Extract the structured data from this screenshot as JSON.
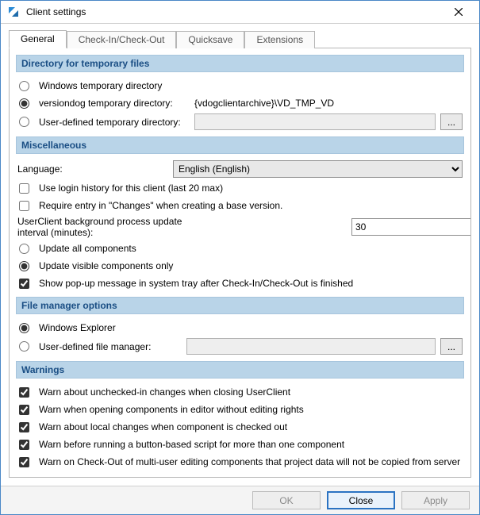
{
  "window": {
    "title": "Client settings"
  },
  "tabs": {
    "general": "General",
    "checkinout": "Check-In/Check-Out",
    "quicksave": "Quicksave",
    "extensions": "Extensions"
  },
  "sections": {
    "tempfiles": {
      "header": "Directory for temporary files",
      "opt_windows": "Windows temporary directory",
      "opt_vdog_label": "versiondog temporary directory:",
      "opt_vdog_value": "{vdogclientarchive}\\VD_TMP_VD",
      "opt_user_label": "User-defined temporary directory:",
      "browse": "..."
    },
    "misc": {
      "header": "Miscellaneous",
      "language_label": "Language:",
      "language_value": "English (English)",
      "use_login_history": "Use login history for this client (last 20 max)",
      "require_changes": "Require entry in \"Changes\" when creating a base version.",
      "bg_update_label_l1": "UserClient background process update",
      "bg_update_label_l2": "interval (minutes):",
      "bg_update_value": "30",
      "update_all": "Update all components",
      "update_visible": "Update visible components only",
      "show_popup": "Show pop-up message in system tray after Check-In/Check-Out is finished"
    },
    "fm": {
      "header": "File manager options",
      "explorer": "Windows Explorer",
      "user_fm_label": "User-defined file manager:",
      "browse": "..."
    },
    "warnings": {
      "header": "Warnings",
      "w1": "Warn about unchecked-in changes when closing UserClient",
      "w2": "Warn when opening components in editor without editing rights",
      "w3": "Warn about local changes when component is checked out",
      "w4": "Warn before running a button-based script for more than one component",
      "w5": "Warn on Check-Out of multi-user editing components that project data will not be copied from server"
    }
  },
  "footer": {
    "ok": "OK",
    "close": "Close",
    "apply": "Apply"
  }
}
